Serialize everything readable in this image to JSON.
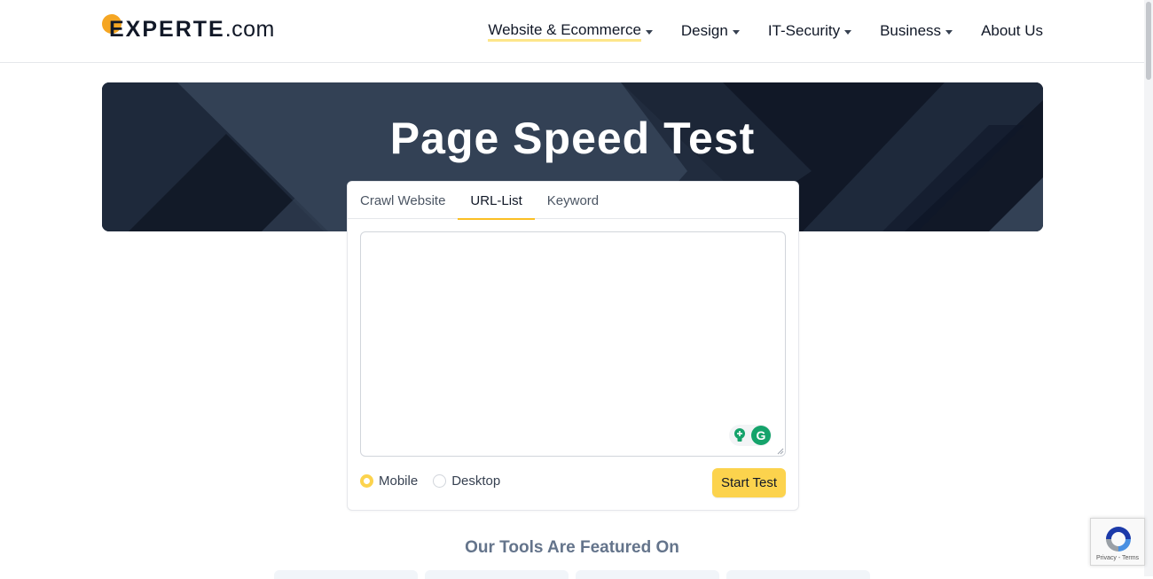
{
  "logo": {
    "main": "EXPERTE",
    "tld": ".com"
  },
  "nav": [
    {
      "label": "Website & Ecommerce",
      "has_caret": true
    },
    {
      "label": "Design",
      "has_caret": true
    },
    {
      "label": "IT-Security",
      "has_caret": true
    },
    {
      "label": "Business",
      "has_caret": true
    },
    {
      "label": "About Us",
      "has_caret": false
    }
  ],
  "hero": {
    "title": "Page Speed Test"
  },
  "tabs": [
    {
      "label": "Crawl Website",
      "active": false
    },
    {
      "label": "URL-List",
      "active": true
    },
    {
      "label": "Keyword",
      "active": false
    }
  ],
  "form": {
    "textarea_value": "",
    "radios": [
      {
        "label": "Mobile",
        "checked": true
      },
      {
        "label": "Desktop",
        "checked": false
      }
    ],
    "start_label": "Start Test"
  },
  "featured": {
    "title": "Our Tools Are Featured On"
  },
  "recaptcha": {
    "text": "Privacy - Terms"
  },
  "colors": {
    "accent": "#fcd34d",
    "hero_dark": "#1e293b",
    "brand_dot": "#f5a623"
  },
  "icons": {
    "grammarly": "grammarly-icon",
    "bulb": "lightbulb-plus-icon",
    "recaptcha": "recaptcha-icon",
    "caret": "caret-down-icon"
  }
}
